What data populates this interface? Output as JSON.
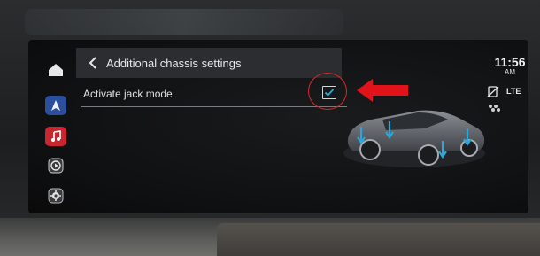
{
  "header": {
    "title": "Additional chassis settings"
  },
  "settings": {
    "jack_mode_label": "Activate jack mode",
    "jack_mode_checked": true
  },
  "status": {
    "time": "11:56",
    "ampm": "AM",
    "network": "LTE"
  },
  "sidebar": {
    "items": [
      "home-icon",
      "navigation-icon",
      "music-icon",
      "carplay-icon",
      "settings-icon"
    ]
  },
  "colors": {
    "accent_checkbox": "#cfd6dc",
    "annotation_red": "#d52a2a",
    "highlight_blue": "#2aa7d8"
  }
}
